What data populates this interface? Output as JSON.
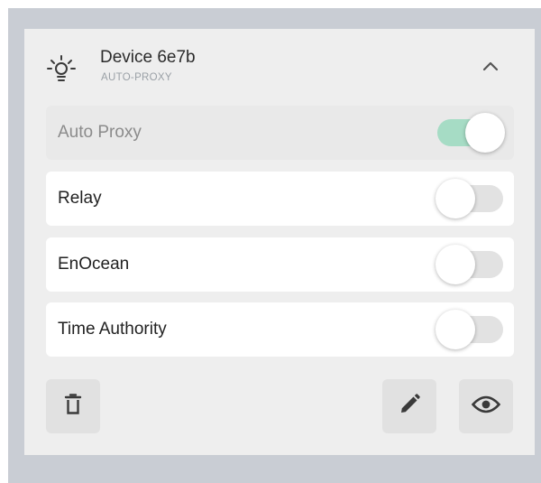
{
  "device": {
    "title": "Device 6e7b",
    "subtitle": "AUTO-PROXY",
    "icon": "lightbulb-icon"
  },
  "header": {
    "collapse_icon": "chevron-up-icon"
  },
  "toggles": [
    {
      "label": "Auto Proxy",
      "on": true,
      "disabled": true
    },
    {
      "label": "Relay",
      "on": false,
      "disabled": false
    },
    {
      "label": "EnOcean",
      "on": false,
      "disabled": false
    },
    {
      "label": "Time Authority",
      "on": false,
      "disabled": false
    }
  ],
  "actions": {
    "delete_icon": "trash-icon",
    "edit_icon": "pencil-icon",
    "view_icon": "eye-icon"
  },
  "colors": {
    "toggle_on_track": "#a6dcc5",
    "toggle_off_track": "#e2e2e2",
    "card_background": "#eeeeee",
    "frame_background": "#c9cdd4"
  }
}
